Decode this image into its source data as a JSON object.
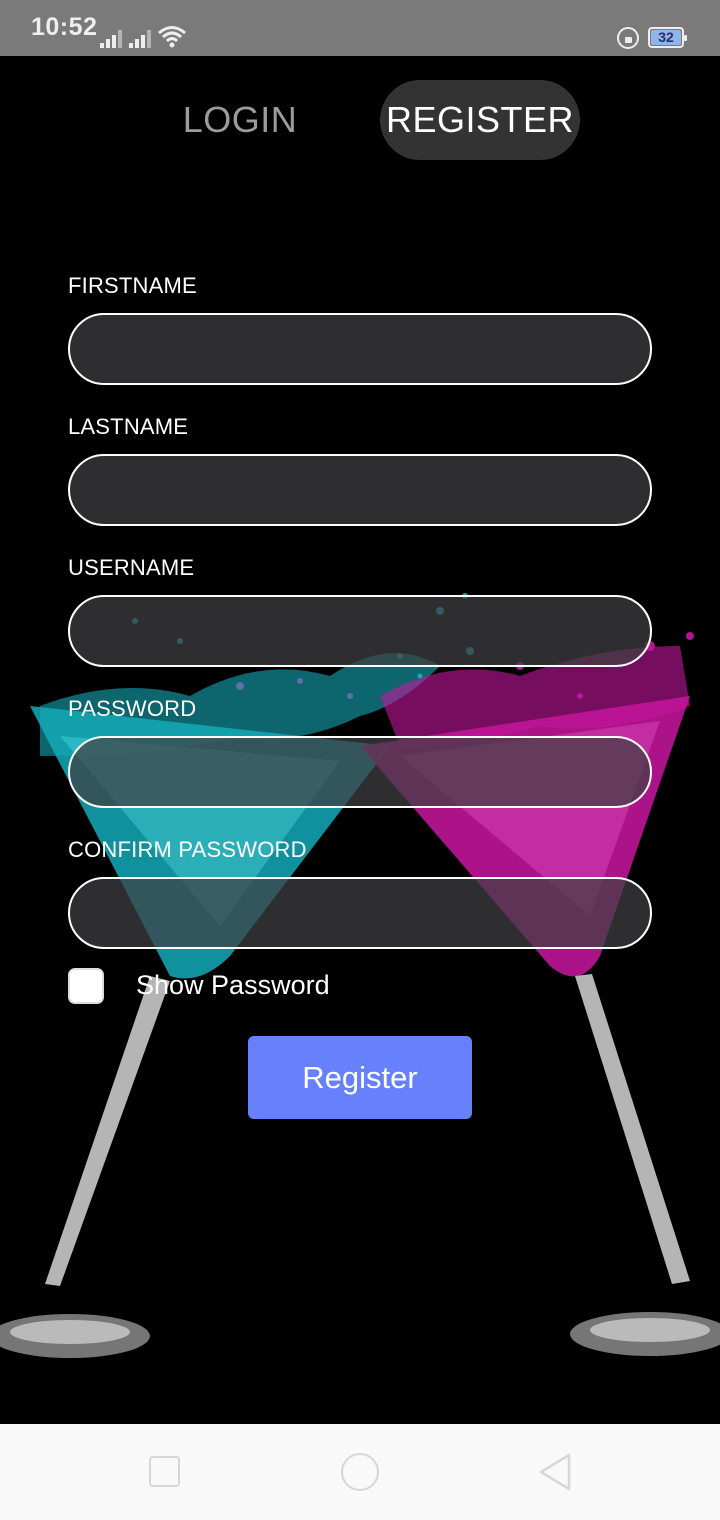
{
  "status": {
    "time": "10:52",
    "battery": "32"
  },
  "tabs": {
    "login": "LOGIN",
    "register": "REGISTER",
    "active": "register"
  },
  "form": {
    "firstname_label": "FIRSTNAME",
    "firstname_value": "",
    "lastname_label": "LASTNAME",
    "lastname_value": "",
    "username_label": "USERNAME",
    "username_value": "",
    "password_label": "PASSWORD",
    "password_value": "",
    "confirm_label": "CONFIRM PASSWORD",
    "confirm_value": "",
    "show_password_label": "Show Password",
    "show_password_checked": false,
    "submit_label": "Register"
  },
  "colors": {
    "accent": "#6780fc",
    "background": "#000000",
    "glass_left": "#1fc7d3",
    "glass_right": "#d41aa8"
  },
  "icons": {
    "status": [
      "signal-icon",
      "signal-icon",
      "wifi-icon",
      "lock-rotation-icon",
      "battery-icon"
    ],
    "nav": [
      "recents-icon",
      "home-icon",
      "back-icon"
    ]
  }
}
